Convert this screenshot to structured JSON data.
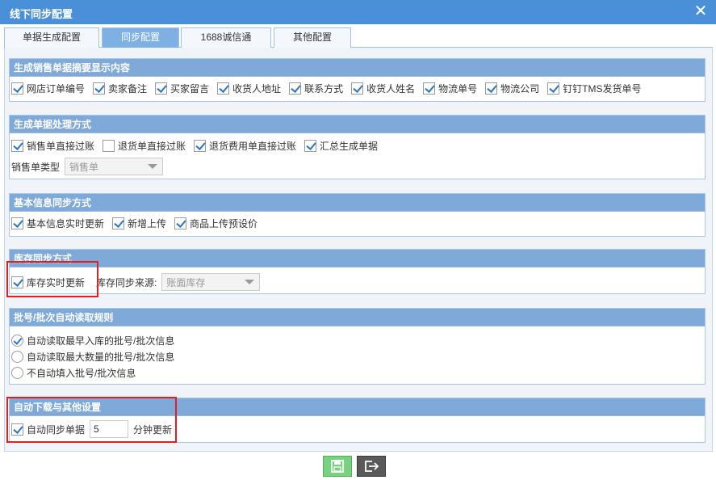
{
  "window": {
    "title": "线下同步配置",
    "close_symbol": "✕"
  },
  "tabs": [
    {
      "label": "单据生成配置",
      "active": false
    },
    {
      "label": "同步配置",
      "active": true
    },
    {
      "label": "1688诚信通",
      "active": false
    },
    {
      "label": "其他配置",
      "active": false
    }
  ],
  "sections": {
    "summary": {
      "title": "生成销售单据摘要显示内容",
      "items": [
        {
          "label": "网店订单编号",
          "checked": true
        },
        {
          "label": "卖家备注",
          "checked": true
        },
        {
          "label": "买家留言",
          "checked": true
        },
        {
          "label": "收货人地址",
          "checked": true
        },
        {
          "label": "联系方式",
          "checked": true
        },
        {
          "label": "收货人姓名",
          "checked": true
        },
        {
          "label": "物流单号",
          "checked": true
        },
        {
          "label": "物流公司",
          "checked": true
        },
        {
          "label": "钉钉TMS发货单号",
          "checked": true
        }
      ]
    },
    "processing": {
      "title": "生成单据处理方式",
      "items": [
        {
          "label": "销售单直接过账",
          "checked": true
        },
        {
          "label": "退货单直接过账",
          "checked": false
        },
        {
          "label": "退货费用单直接过账",
          "checked": true
        },
        {
          "label": "汇总生成单据",
          "checked": true
        }
      ],
      "type_label": "销售单类型",
      "type_value": "销售单"
    },
    "basic": {
      "title": "基本信息同步方式",
      "items": [
        {
          "label": "基本信息实时更新",
          "checked": true
        },
        {
          "label": "新增上传",
          "checked": true
        },
        {
          "label": "商品上传预设价",
          "checked": true
        }
      ]
    },
    "stock": {
      "title": "库存同步方式",
      "realtime_label": "库存实时更新",
      "realtime_checked": true,
      "source_label": "库存同步来源:",
      "source_value": "账面库存"
    },
    "batch": {
      "title": "批号/批次自动读取规则",
      "options": [
        {
          "label": "自动读取最早入库的批号/批次信息",
          "checked": true
        },
        {
          "label": "自动读取最大数量的批号/批次信息",
          "checked": false
        },
        {
          "label": "不自动填入批号/批次信息",
          "checked": false
        }
      ]
    },
    "auto": {
      "title": "自动下载与其他设置",
      "sync_label": "自动同步单据",
      "sync_checked": true,
      "minutes_value": "5",
      "minutes_suffix": "分钟更新"
    }
  },
  "footer": {
    "save_icon": "save-icon",
    "exit_icon": "exit-icon"
  },
  "colors": {
    "titlebar": "#4a90d9",
    "section_header": "#7ea9d8",
    "highlight": "#e21f1f",
    "check": "#2b76c4",
    "save_button": "#79d27f",
    "exit_button": "#5a5a5a"
  }
}
